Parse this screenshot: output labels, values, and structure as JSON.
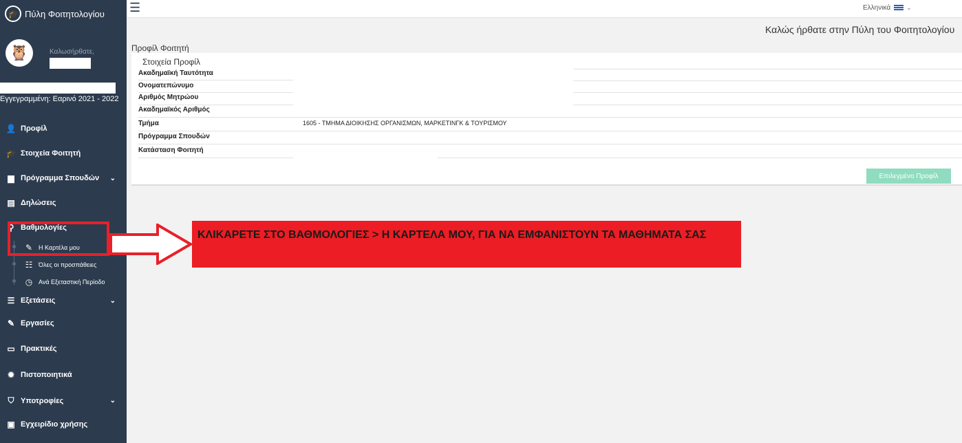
{
  "sidebar": {
    "brand_title": "Πύλη Φοιτητολογίου",
    "welcome": "Καλωσήρθατε,",
    "enrolled": "Εγγεγραμμένη: Εαρινό 2021 - 2022",
    "items": [
      {
        "label": "Προφίλ",
        "icon": "profile-icon"
      },
      {
        "label": "Στοιχεία Φοιτητή",
        "icon": "student-icon"
      },
      {
        "label": "Πρόγραμμα Σπουδών",
        "icon": "curriculum-icon"
      },
      {
        "label": "Δηλώσεις",
        "icon": "declarations-icon"
      },
      {
        "label": "Βαθμολογίες",
        "icon": "grades-icon"
      },
      {
        "label": "Εξετάσεις",
        "icon": "exams-icon"
      },
      {
        "label": "Εργασίες",
        "icon": "assignments-icon"
      },
      {
        "label": "Πρακτικές",
        "icon": "internships-icon"
      },
      {
        "label": "Πιστοποιητικά",
        "icon": "certificates-icon"
      },
      {
        "label": "Υποτροφίες",
        "icon": "scholarships-icon"
      },
      {
        "label": "Εγχειρίδιο χρήσης",
        "icon": "manual-icon"
      }
    ],
    "sub_items": [
      {
        "label": "Η Καρτέλα μου",
        "icon": "card-icon"
      },
      {
        "label": "Όλες οι προσπάθειες",
        "icon": "attempts-icon"
      },
      {
        "label": "Ανά Εξεταστική Περίοδο",
        "icon": "clock-icon"
      }
    ]
  },
  "topbar": {
    "language": "Ελληνικά"
  },
  "main": {
    "welcome_title": "Καλώς ήρθατε στην Πύλη του Φοιτητολογίου",
    "section_title": "Προφίλ Φοιτητή",
    "card_subtitle": "Στοιχεία Προφίλ",
    "rows": [
      {
        "label": "Ακαδημαϊκή Ταυτότητα",
        "value": ""
      },
      {
        "label": "Ονοματεπώνυμο",
        "value": ""
      },
      {
        "label": "Αριθμός Μητρώου",
        "value": ""
      },
      {
        "label": "Ακαδημαϊκός Αριθμός",
        "value": ""
      },
      {
        "label": "Τμήμα",
        "value": "1605 - ΤΜΗΜΑ ΔΙΟΙΚΗΣΗΣ ΟΡΓΑΝΙΣΜΩΝ, ΜΑΡΚΕΤΙΝΓΚ & ΤΟΥΡΙΣΜΟΥ"
      },
      {
        "label": "Πρόγραμμα Σπουδών",
        "value": ""
      },
      {
        "label": "Κατάσταση Φοιτητή",
        "value": ""
      }
    ],
    "selected_profile_button": "Επιλεγμένο Προφίλ"
  },
  "annotation": {
    "callout_text": "ΚΛΙΚΑΡΕΤΕ ΣΤΟ ΒΑΘΜΟΛΟΓΙΕΣ > Η ΚΑΡΤΕΛΑ ΜΟΥ, ΓΙΑ ΝΑ ΕΜΦΑΝΙΣΤΟΥΝ ΤΑ ΜΑΘΗΜΑΤΑ ΣΑΣ",
    "color": "#ec1d24"
  }
}
